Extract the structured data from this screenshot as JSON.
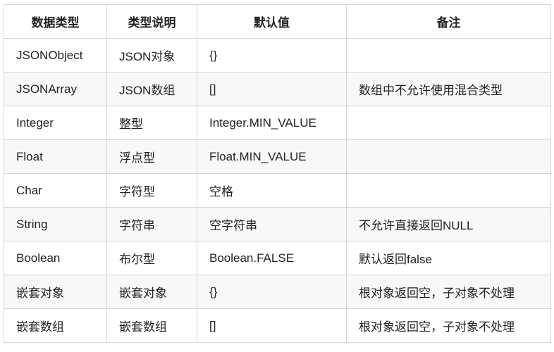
{
  "table": {
    "headers": [
      "数据类型",
      "类型说明",
      "默认值",
      "备注"
    ],
    "rows": [
      [
        "JSONObject",
        "JSON对象",
        "{}",
        ""
      ],
      [
        "JSONArray",
        "JSON数组",
        "[]",
        "数组中不允许使用混合类型"
      ],
      [
        "Integer",
        "整型",
        "Integer.MIN_VALUE",
        ""
      ],
      [
        "Float",
        "浮点型",
        "Float.MIN_VALUE",
        ""
      ],
      [
        "Char",
        "字符型",
        "空格",
        ""
      ],
      [
        "String",
        "字符串",
        "空字符串",
        "不允许直接返回NULL"
      ],
      [
        "Boolean",
        "布尔型",
        "Boolean.FALSE",
        "默认返回false"
      ],
      [
        "嵌套对象",
        "嵌套对象",
        "{}",
        "根对象返回空，子对象不处理"
      ],
      [
        "嵌套数组",
        "嵌套数组",
        "[]",
        "根对象返回空，子对象不处理"
      ]
    ]
  }
}
